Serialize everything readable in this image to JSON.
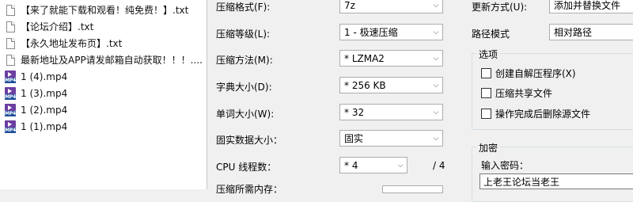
{
  "files": [
    {
      "name": "【来了就能下载和观看！纯免费！】.txt",
      "icon": "text-file-icon"
    },
    {
      "name": "【论坛介绍】.txt",
      "icon": "text-file-icon"
    },
    {
      "name": "【永久地址发布页】.txt",
      "icon": "text-file-icon"
    },
    {
      "name": "最新地址及APP请发邮箱自动获取！！！....",
      "icon": "text-file-icon"
    },
    {
      "name": "1 (4).mp4",
      "icon": "mp4-file-icon"
    },
    {
      "name": "1 (3).mp4",
      "icon": "mp4-file-icon"
    },
    {
      "name": "1 (2).mp4",
      "icon": "mp4-file-icon"
    },
    {
      "name": "1 (1).mp4",
      "icon": "mp4-file-icon"
    }
  ],
  "mp4_badge": "MP4",
  "compression": {
    "format_label": "压缩格式(F):",
    "format_value": "7z",
    "level_label": "压缩等级(L):",
    "level_value": "1 - 极速压缩",
    "method_label": "压缩方法(M):",
    "method_value": "* LZMA2",
    "dict_label": "字典大小(D):",
    "dict_value": "* 256 KB",
    "word_label": "单词大小(W):",
    "word_value": "* 32",
    "solid_label": "固实数据大小：",
    "solid_value": "固实",
    "threads_label": "CPU 线程数：",
    "threads_value": "* 4",
    "threads_total": "/ 4",
    "memory_label": "压缩所需内存："
  },
  "right": {
    "update_label": "更新方式(U):",
    "update_value": "添加并替换文件",
    "path_label": "路径模式",
    "path_value": "相对路径",
    "options_title": "选项",
    "opt_sfx": "创建自解压程序(X)",
    "opt_shared": "压缩共享文件",
    "opt_delete": "操作完成后删除源文件",
    "encrypt_title": "加密",
    "password_label": "输入密码：",
    "password_value": "上老王论坛当老王"
  }
}
